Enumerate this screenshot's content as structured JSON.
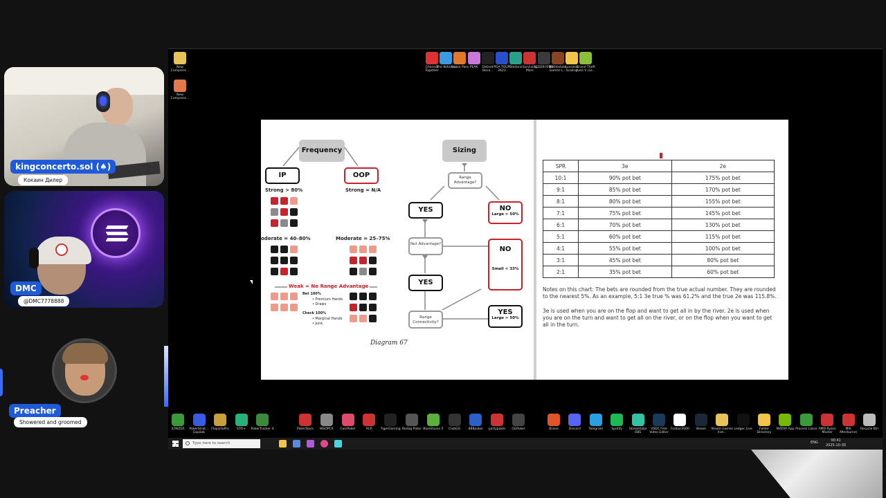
{
  "participants": [
    {
      "name": "kingconcerto.sol (♠)",
      "subtitle": "Кокаин Дилер"
    },
    {
      "name": "DMC",
      "subtitle": "@DMC7778888"
    },
    {
      "name": "Preacher",
      "subtitle": "Showered and groomed"
    }
  ],
  "desktop": {
    "left_icons": [
      "New Compress...",
      "New Compress..."
    ],
    "top_icons": [
      "Channel Together",
      "The Witness",
      "Snake Pass",
      "PEAK",
      "Detroit Beco...",
      "PGA TOUR 2K23",
      "Stellaris",
      "Surviving Mars",
      "ELDEN RING",
      "Battlestate Games L...",
      "Lossless Scaling",
      "Grand Theft Auto V (Le..."
    ],
    "bottom_icons_left": [
      "ICMIZER",
      "PokerStrat... Equilab",
      "FlopzillaPro",
      "GTO+",
      "PokerTracker 4",
      "PokerStars",
      "WSOPCA",
      "CoinPoker",
      "ACR",
      "TigerGaming",
      "Bodog Poker",
      "BlueStacks 5",
      "ClubGG",
      "888poker",
      "partypoker",
      "GGPoker"
    ],
    "bottom_icons_right": [
      "Brave",
      "Discord",
      "Telegram",
      "Spotify",
      "Streamlabs OBS",
      "VSDC Free Video Editor",
      "Foobar2000",
      "Steam",
      "Steam Games Inst...",
      "Ledger Live",
      "Folder Directory",
      "NVIDIA App",
      "Process Lasso",
      "AMD Ryzen Master",
      "MSI Afterburner",
      "Recycle Bin"
    ]
  },
  "taskbar": {
    "search_placeholder": "Type here to search",
    "time": "00:41",
    "date": "2025-10-30",
    "lang": "ENG"
  },
  "diagram": {
    "frequency": "Frequency",
    "sizing": "Sizing",
    "ip": "IP",
    "oop": "OOP",
    "strong_ip": "Strong > 80%",
    "strong_oop": "Strong = N/A",
    "moderate_ip": "oderate = 40–80%",
    "moderate_oop": "Moderate = 25–75%",
    "weak": "Weak = No Range Advantage",
    "bet100": "Bet 100%",
    "bet_items": [
      "• Premium Hands",
      "• Draws"
    ],
    "check100": "Check 100%",
    "check_items": [
      "• Marginal Hands",
      "• Junk"
    ],
    "range_adv": "Range Advantage?",
    "nut_adv": "Nut Advantage?",
    "range_conn": "Range Connectivity?",
    "yes": "YES",
    "no": "NO",
    "large50": "Large > 50%",
    "small33": "Small < 33%",
    "caption": "Diagram 67"
  },
  "spr_table": {
    "headers": [
      "SPR",
      "3e",
      "2e"
    ],
    "rows": [
      [
        "10:1",
        "90% pot bet",
        "175% pot bet"
      ],
      [
        "9:1",
        "85% pot bet",
        "170% pot bet"
      ],
      [
        "8:1",
        "80% pot bet",
        "155% pot bet"
      ],
      [
        "7:1",
        "75% pot bet",
        "145% pot bet"
      ],
      [
        "6:1",
        "70% pot bet",
        "130% pot bet"
      ],
      [
        "5:1",
        "60% pot bet",
        "115% pot bet"
      ],
      [
        "4:1",
        "55% pot bet",
        "100% pot bet"
      ],
      [
        "3:1",
        "45% pot bet",
        "80% pot bet"
      ],
      [
        "2:1",
        "35% pot bet",
        "60% pot bet"
      ]
    ],
    "note1": "Notes on this chart: The bets are rounded from the true actual number. They are rounded to the nearest 5%. As an example, 5:1 3e true % was 61.2% and the true 2e was 115.8%.",
    "note2": "3e is used when you are on the flop and want to get all in by the river. 2e is used when you are on the turn and want to get all on the river, or on the flop when you want to get all in the turn."
  },
  "colors": {
    "accent_blue": "#1f5bd8",
    "card_red": "#c8232c",
    "card_pink": "#f09a8a",
    "card_dark": "#1a1a1a",
    "card_gray": "#8a8a8a"
  }
}
